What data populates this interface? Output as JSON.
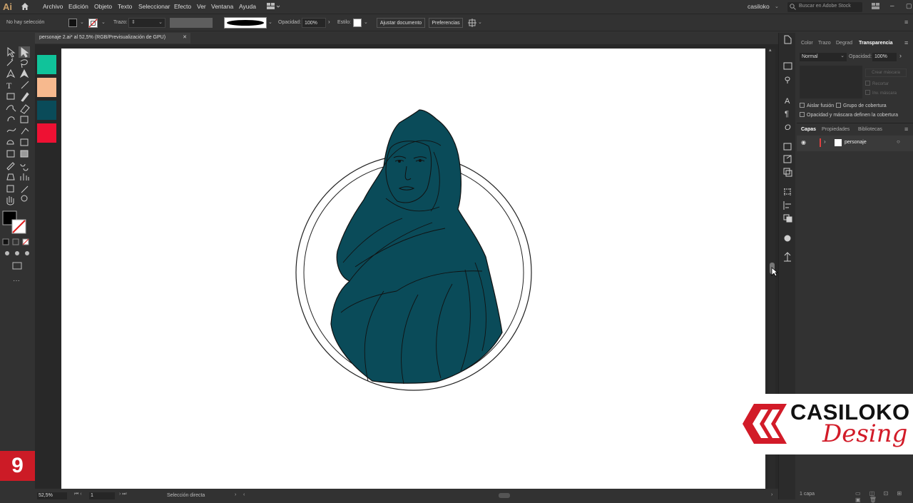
{
  "app": {
    "logo": "Ai",
    "user": "casiloko",
    "search_placeholder": "Buscar en Adobe Stock"
  },
  "menu": [
    "Archivo",
    "Edición",
    "Objeto",
    "Texto",
    "Seleccionar",
    "Efecto",
    "Ver",
    "Ventana",
    "Ayuda"
  ],
  "control": {
    "selection": "No hay selección",
    "stroke_label": "Trazo:",
    "opacity_label": "Opacidad:",
    "opacity_value": "100%",
    "style_label": "Estilo:",
    "fit_button": "Ajustar documento",
    "prefs_button": "Preferencias"
  },
  "document_tab": "personaje 2.ai* al 52,5% (RGB/Previsualización de GPU)",
  "swatches": [
    "#10c39a",
    "#f7b98e",
    "#0a4b59",
    "#ee1133"
  ],
  "panel": {
    "tabs": [
      "Color",
      "Trazo",
      "Degrad",
      "Transparencia"
    ],
    "blend_mode": "Normal",
    "opacity_label": "Opacidad:",
    "opacity_value": "100%",
    "make_mask": "Crear máscara",
    "clip": "Recortar",
    "invert_mask": "Inv. máscara",
    "isolate": "Aislar fusión",
    "knockout": "Grupo de cobertura",
    "opacity_mask": "Opacidad y máscara definen la cobertura",
    "layer_tabs": [
      "Capas",
      "Propiedades",
      "Bibliotecas"
    ],
    "layer_name": "personaje",
    "layer_count": "1 capa"
  },
  "status": {
    "zoom": "52,5%",
    "artboard": "1",
    "tool": "Selección directa"
  },
  "brand": {
    "name": "CASILOKO",
    "script": "Desing",
    "badge": "9"
  }
}
